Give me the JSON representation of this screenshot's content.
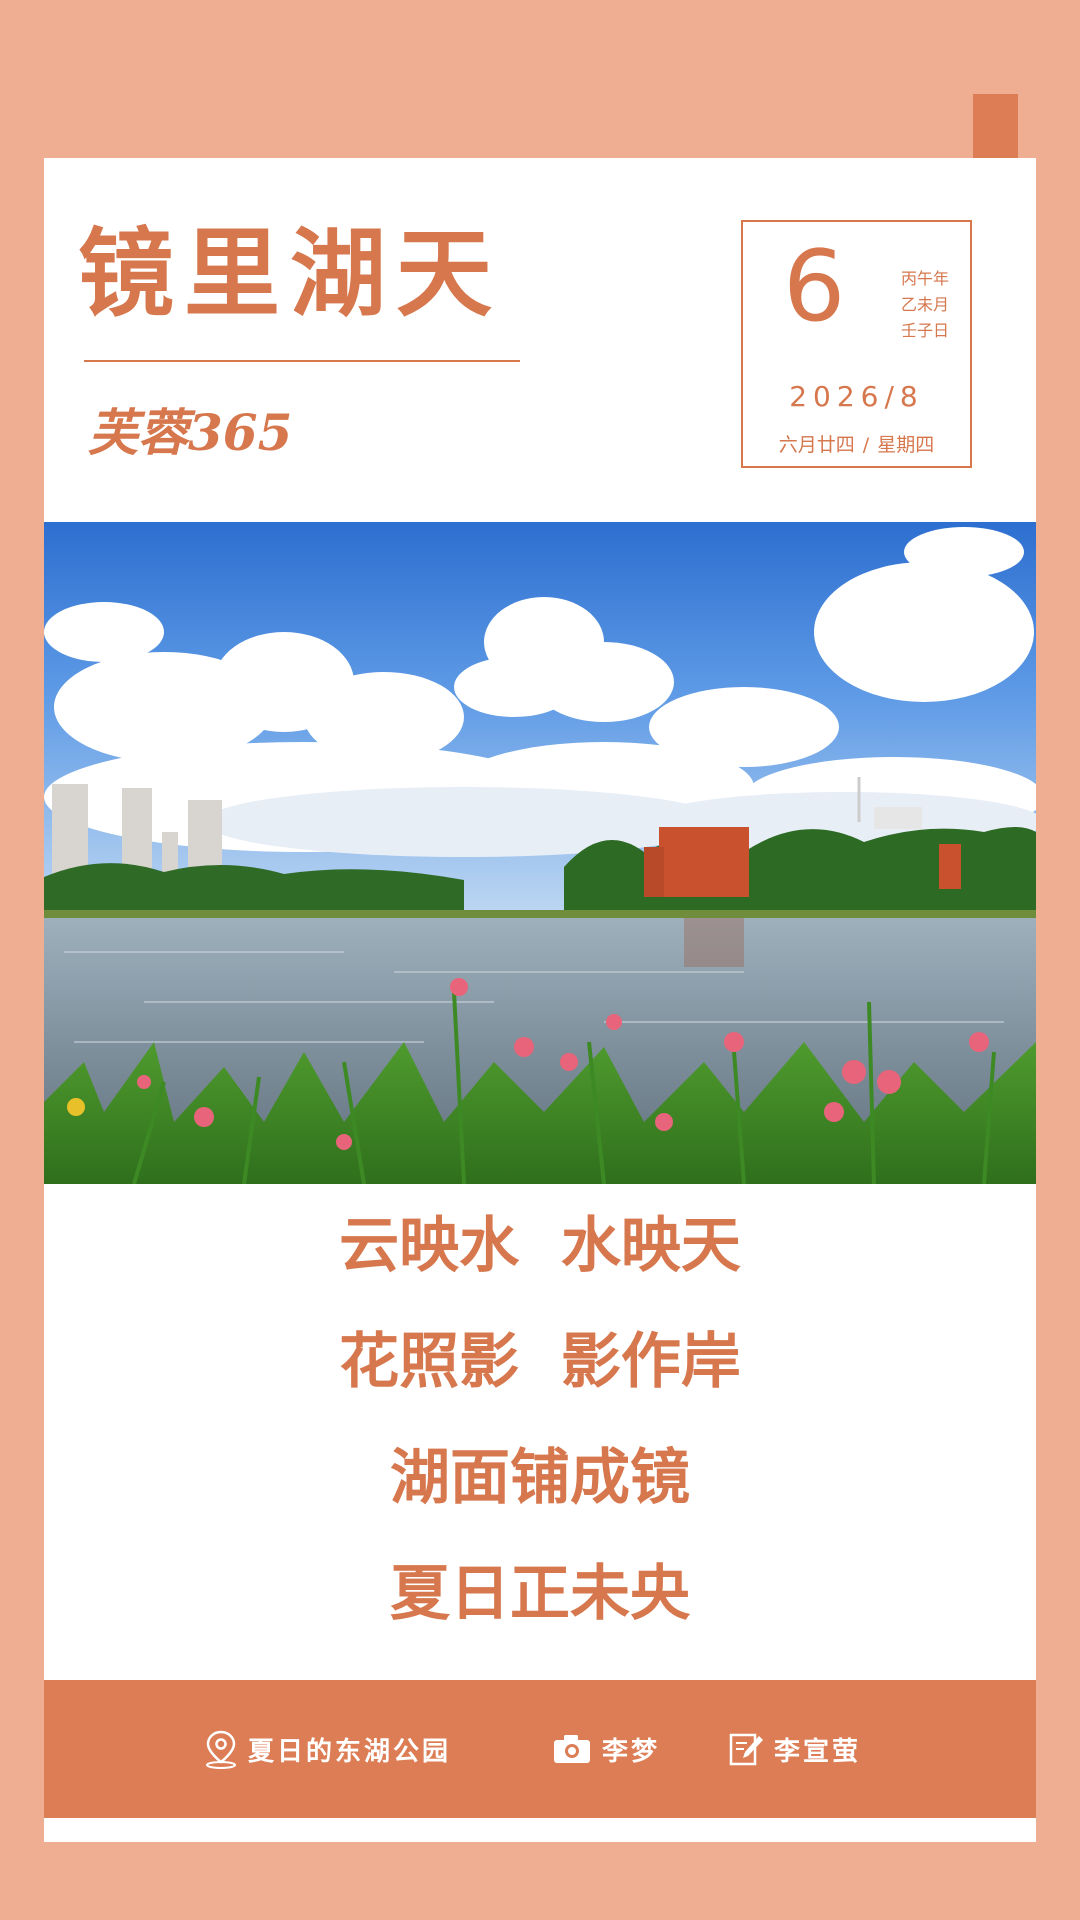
{
  "header": {
    "title": "镜里湖天",
    "subtitle": "芙蓉365"
  },
  "date_box": {
    "day": "6",
    "ganzhi_year": "丙午年",
    "ganzhi_month": "乙未月",
    "ganzhi_day": "壬子日",
    "year_month": "2026/8",
    "lunar_date": "六月廿四",
    "separator": "/",
    "weekday": "星期四"
  },
  "photo": {
    "description_icon": "lake-landscape-photo"
  },
  "poem": {
    "lines": [
      "云映水  水映天",
      "花照影  影作岸",
      "湖面铺成镜",
      "夏日正未央"
    ]
  },
  "footer": {
    "location": "夏日的东湖公园",
    "photographer": "李梦",
    "writer": "李宣萤",
    "icons": [
      "location-pin-icon",
      "camera-icon",
      "edit-note-icon"
    ]
  },
  "colors": {
    "background": "#efae92",
    "accent": "#d6774d",
    "footer": "#dc7d55",
    "card": "#ffffff"
  }
}
